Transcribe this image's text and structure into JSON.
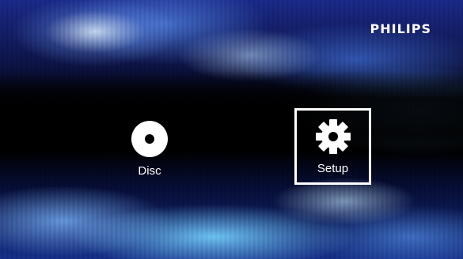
{
  "brand": {
    "logo_text": "PHILIPS"
  },
  "menu": {
    "items": [
      {
        "label": "Disc",
        "icon": "disc-icon",
        "selected": false
      },
      {
        "label": "Setup",
        "icon": "gear-icon",
        "selected": true
      }
    ]
  },
  "colors": {
    "text": "#ffffff",
    "selection_border": "#ffffff",
    "background_dark": "#000000",
    "background_accent": "#2a6dff"
  }
}
